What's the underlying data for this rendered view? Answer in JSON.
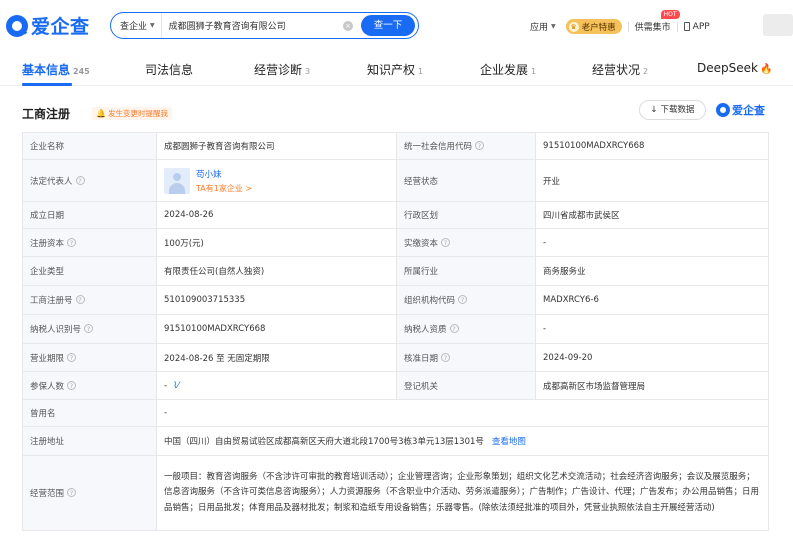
{
  "header": {
    "logo_text": "爱企查",
    "search_type": "查企业",
    "search_value": "成都圆狮子教育咨询有限公司",
    "search_button": "查一下",
    "nav_app": "应用",
    "nav_vip": "老户特惠",
    "nav_supply": "供需集市",
    "nav_hot": "HOT",
    "nav_app_download": "APP"
  },
  "tabs": [
    {
      "label": "基本信息",
      "count": "245"
    },
    {
      "label": "司法信息",
      "count": ""
    },
    {
      "label": "经营诊断",
      "count": "3"
    },
    {
      "label": "知识产权",
      "count": "1"
    },
    {
      "label": "企业发展",
      "count": "1"
    },
    {
      "label": "经营状况",
      "count": "2"
    },
    {
      "label": "DeepSeek",
      "count": ""
    }
  ],
  "section": {
    "title": "工商注册",
    "alert": "发生变更时提醒我",
    "download": "下载数据",
    "brand": "爱企查"
  },
  "info": {
    "company_name_label": "企业名称",
    "company_name": "成都圆狮子教育咨询有限公司",
    "credit_code_label": "统一社会信用代码",
    "credit_code": "91510100MADXRCY668",
    "legal_rep_label": "法定代表人",
    "legal_rep_name": "苟小妹",
    "legal_rep_sub": "TA有1家企业 >",
    "status_label": "经营状态",
    "status": "开业",
    "found_date_label": "成立日期",
    "found_date": "2024-08-26",
    "region_label": "行政区划",
    "region": "四川省成都市武侯区",
    "reg_capital_label": "注册资本",
    "reg_capital": "100万(元)",
    "paid_capital_label": "实缴资本",
    "paid_capital": "-",
    "type_label": "企业类型",
    "type": "有限责任公司(自然人独资)",
    "industry_label": "所属行业",
    "industry": "商务服务业",
    "reg_no_label": "工商注册号",
    "reg_no": "510109003715335",
    "org_code_label": "组织机构代码",
    "org_code": "MADXRCY6-6",
    "tax_id_label": "纳税人识别号",
    "tax_id": "91510100MADXRCY668",
    "tax_qual_label": "纳税人资质",
    "tax_qual": "-",
    "term_label": "营业期限",
    "term": "2024-08-26 至 无固定期限",
    "approve_date_label": "核准日期",
    "approve_date": "2024-09-20",
    "insured_label": "参保人数",
    "insured": "-",
    "authority_label": "登记机关",
    "authority": "成都高新区市场监督管理局",
    "former_name_label": "曾用名",
    "former_name": "-",
    "address_label": "注册地址",
    "address": "中国（四川）自由贸易试验区成都高新区天府大道北段1700号3栋3单元13层1301号",
    "address_link": "查看地图",
    "scope_label": "经营范围",
    "scope": "一般项目：教育咨询服务（不含涉许可审批的教育培训活动）；企业管理咨询；企业形象策划；组织文化艺术交流活动；社会经济咨询服务；会议及展览服务；信息咨询服务（不含许可类信息咨询服务）；人力资源服务（不含职业中介活动、劳务派遣服务）；广告制作；广告设计、代理；广告发布；办公用品销售；日用品销售；日用品批发；体育用品及器材批发；制浆和造纸专用设备销售；乐器零售。(除依法须经批准的项目外，凭营业执照依法自主开展经营活动)"
  }
}
